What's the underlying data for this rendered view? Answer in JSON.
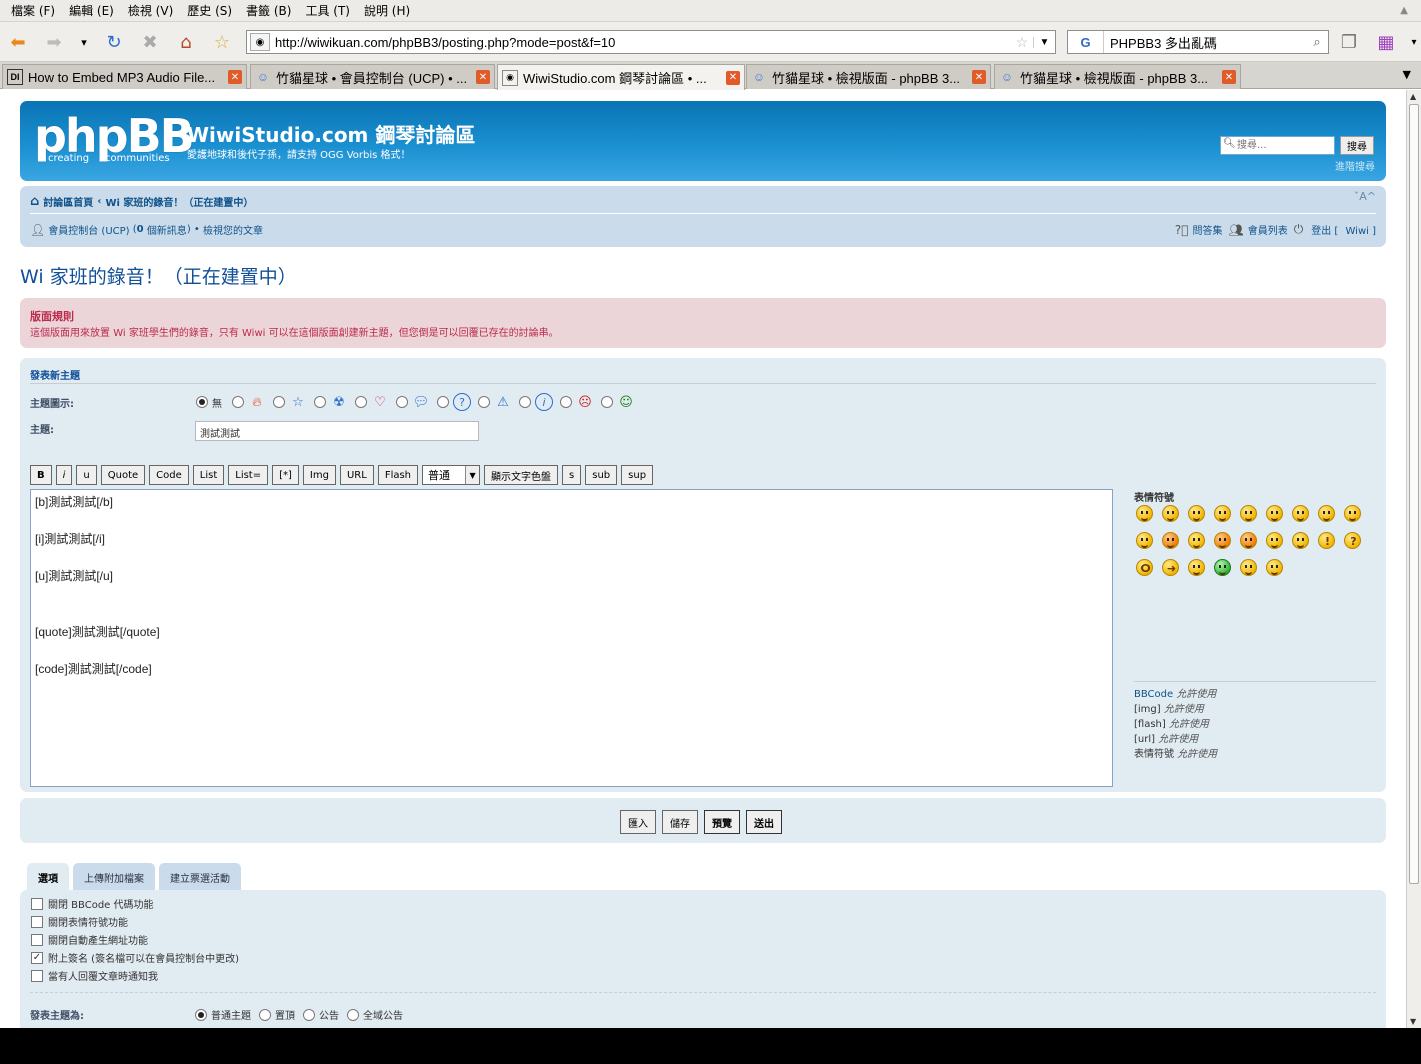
{
  "menubar": [
    "檔案 (F)",
    "編輯 (E)",
    "檢視 (V)",
    "歷史 (S)",
    "書籤 (B)",
    "工具 (T)",
    "說明 (H)"
  ],
  "browser": {
    "url": "http://wiwikuan.com/phpBB3/posting.php?mode=post&f=10",
    "search_engine": "G",
    "search_value": "PHPBB3 多出亂碼",
    "tabs": [
      {
        "label": "How to Embed MP3 Audio File...",
        "favicon": "DI"
      },
      {
        "label": "竹貓星球 • 會員控制台 (UCP) • ...",
        "favicon": "cat"
      },
      {
        "label": "WiwiStudio.com 鋼琴討論區 • ...",
        "favicon": "page",
        "active": true
      },
      {
        "label": "竹貓星球 • 檢視版面 - phpBB 3...",
        "favicon": "cat"
      },
      {
        "label": "竹貓星球 • 檢視版面 - phpBB 3...",
        "favicon": "cat"
      }
    ]
  },
  "site": {
    "logo": "phpBB",
    "logo_tagline_left": "creating",
    "logo_tagline_right": "communities",
    "title": "WiwiStudio.com 鋼琴討論區",
    "description": "愛護地球和後代子孫，請支持 OGG Vorbis 格式！",
    "search_placeholder": "搜尋...",
    "search_button": "搜尋",
    "advanced_search": "進階搜尋"
  },
  "nav": {
    "breadcrumb_home": "討論區首頁",
    "breadcrumb_sep": "‹",
    "breadcrumb_forum": "Wi 家班的錄音！（正在建置中）",
    "font_size": "ˇA^",
    "ucp": "會員控制台 (UCP)",
    "new_messages_count": "0",
    "new_messages": "個新訊息",
    "view_posts": "檢視您的文章",
    "faq": "問答集",
    "memberlist": "會員列表",
    "logout": "登出",
    "username": "Wiwi"
  },
  "forum_title": "Wi 家班的錄音！（正在建置中）",
  "rules": {
    "title": "版面規則",
    "text_before": "這個版面用來放置",
    "text_wi": "Wi",
    "text_mid": "家班學生們的錄音，只有",
    "text_wiwi": "Wiwi",
    "text_after": "可以在這個版面創建新主題，但您倒是可以回覆已存在的討論串。"
  },
  "post": {
    "panel_title": "發表新主題",
    "icon_label": "主題圖示:",
    "icon_none": "無",
    "subject_label": "主題:",
    "subject_value": "測試測試",
    "bbcode_buttons": [
      "B",
      "i",
      "u",
      "Quote",
      "Code",
      "List",
      "List=",
      "[*]",
      "Img",
      "URL",
      "Flash"
    ],
    "font_size_select": "普通",
    "color_button": "顯示文字色盤",
    "extra_buttons": [
      "s",
      "sub",
      "sup"
    ],
    "message_lines": [
      "[b]測試測試[/b]",
      "",
      "[i]測試測試[/i]",
      "",
      "[u]測試測試[/u]",
      "",
      "",
      "[quote]測試測試[/quote]",
      "",
      "[code]測試測試[/code]"
    ],
    "smilies_title": "表情符號",
    "permissions": {
      "bbcode": "BBCode",
      "img": "[img]",
      "flash": "[flash]",
      "url": "[url]",
      "smilies": "表情符號",
      "allowed": "允許使用"
    }
  },
  "submit": {
    "import": "匯入",
    "save": "儲存",
    "preview": "預覽",
    "submit": "送出"
  },
  "option_tabs": [
    "選項",
    "上傳附加檔案",
    "建立票選活動"
  ],
  "options": [
    {
      "label": "關閉 BBCode 代碼功能",
      "checked": false
    },
    {
      "label": "關閉表情符號功能",
      "checked": false
    },
    {
      "label": "關閉自動產生網址功能",
      "checked": false
    },
    {
      "label": "附上簽名 (簽名檔可以在會員控制台中更改)",
      "checked": true
    },
    {
      "label": "當有人回覆文章時通知我",
      "checked": false
    }
  ],
  "post_type": {
    "label": "發表主題為:",
    "options": [
      "普通主題",
      "置頂",
      "公告",
      "全域公告"
    ],
    "selected": "普通主題"
  }
}
